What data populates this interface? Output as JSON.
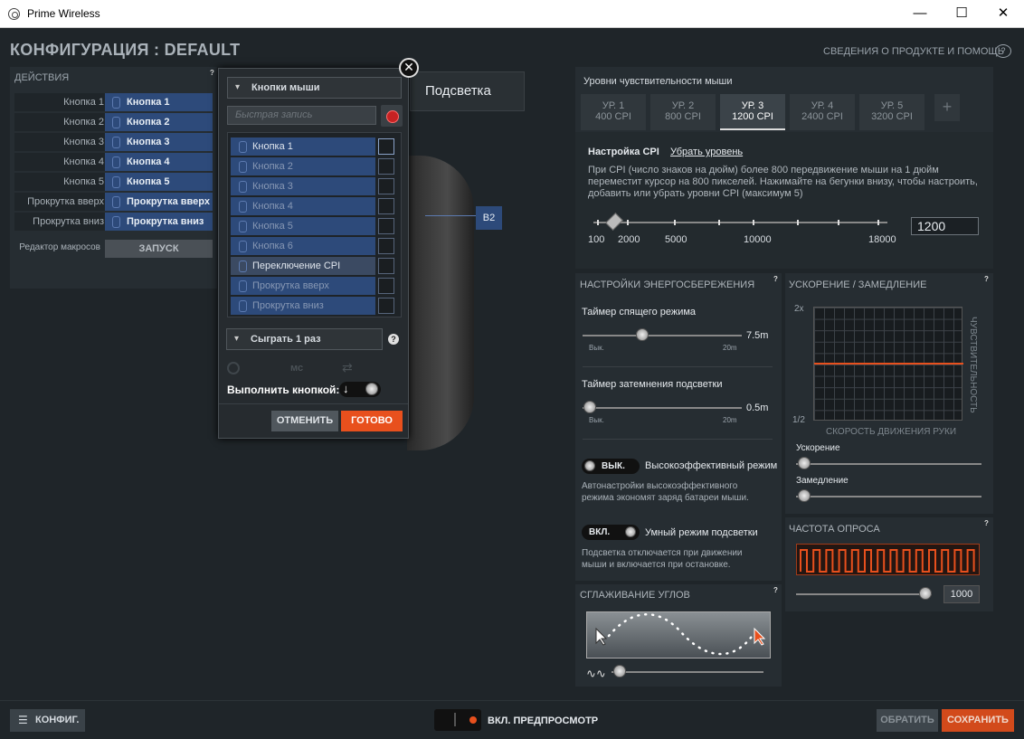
{
  "window": {
    "title": "Prime Wireless",
    "min": "—",
    "max": "☐",
    "close": "✕"
  },
  "header": {
    "title": "КОНФИГУРАЦИЯ : DEFAULT",
    "help": "СВЕДЕНИЯ О ПРОДУКТЕ И ПОМОЩЬ",
    "q": "?"
  },
  "actions": {
    "title": "ДЕЙСТВИЯ",
    "rows": [
      {
        "label": "Кнопка 1",
        "value": "Кнопка 1"
      },
      {
        "label": "Кнопка 2",
        "value": "Кнопка 2"
      },
      {
        "label": "Кнопка 3",
        "value": "Кнопка 3"
      },
      {
        "label": "Кнопка 4",
        "value": "Кнопка 4"
      },
      {
        "label": "Кнопка 5",
        "value": "Кнопка 5"
      },
      {
        "label": "Прокрутка вверх",
        "value": "Прокрутка вверх"
      },
      {
        "label": "Прокрутка вниз",
        "value": "Прокрутка вниз"
      }
    ],
    "macro_label": "Редактор макросов",
    "launch": "ЗАПУСК"
  },
  "popup": {
    "category": "Кнопки мыши",
    "quick_placeholder": "Быстрая запись",
    "buttons": [
      "Кнопка 1",
      "Кнопка 2",
      "Кнопка 3",
      "Кнопка 4",
      "Кнопка 5",
      "Кнопка 6",
      "Переключение CPI",
      "Прокрутка вверх",
      "Прокрутка вниз"
    ],
    "play": "Сыграть 1 раз",
    "ms": "мс",
    "execute": "Выполнить кнопкой:",
    "cancel": "ОТМЕНИТЬ",
    "done": "ГОТОВО",
    "close": "✕",
    "q": "?"
  },
  "backlight_tab": "Подсветка",
  "mouse": {
    "b2": "B2"
  },
  "sensitivity": {
    "title": "Уровни чувствительности мыши",
    "levels": [
      {
        "name": "УР. 1",
        "cpi": "400 CPI"
      },
      {
        "name": "УР. 2",
        "cpi": "800 CPI"
      },
      {
        "name": "УР. 3",
        "cpi": "1200 CPI"
      },
      {
        "name": "УР. 4",
        "cpi": "2400 CPI"
      },
      {
        "name": "УР. 5",
        "cpi": "3200 CPI"
      }
    ],
    "active_level": 3,
    "add": "+",
    "cpi_settings": "Настройка CPI",
    "remove_level": "Убрать уровень",
    "desc": "При CPI (число знаков на дюйм) более 800 передвижение мыши на 1 дюйм переместит курсор на 800 пикселей. Нажимайте на бегунки внизу, чтобы настроить, добавить или убрать уровни CPI (максимум 5)",
    "scale": [
      "100",
      "2000",
      "5000",
      "10000",
      "18000"
    ],
    "value": "1200"
  },
  "power": {
    "title": "НАСТРОЙКИ ЭНЕРГОСБЕРЕЖЕНИЯ",
    "q": "?",
    "sleep": {
      "label": "Таймер спящего режима",
      "min": "Вык.",
      "max": "20m",
      "value": "7.5m",
      "fraction": 0.375
    },
    "dim": {
      "label": "Таймер затемнения подсветки",
      "min": "Вык.",
      "max": "20m",
      "value": "0.5m",
      "fraction": 0.025
    },
    "hi_eff": {
      "state": "ВЫК.",
      "label": "Высокоэффективный режим",
      "desc": "Автонастройки высокоэффективного режима экономят заряд батареи мыши."
    },
    "smart": {
      "state": "ВКЛ.",
      "label": "Умный режим подсветки",
      "desc": "Подсветка отключается при движении мыши и включается при остановке."
    }
  },
  "accel": {
    "title": "УСКОРЕНИЕ / ЗАМЕДЛЕНИЕ",
    "q": "?",
    "y_top": "2x",
    "y_bot": "1/2",
    "y_axis": "ЧУВСТВИТЕЛЬНОСТЬ",
    "x_axis": "СКОРОСТЬ ДВИЖЕНИЯ РУКИ",
    "accel": "Ускорение",
    "decel": "Замедление"
  },
  "polling": {
    "title": "ЧАСТОТА ОПРОСА",
    "q": "?",
    "value": "1000"
  },
  "smoothing": {
    "title": "СГЛАЖИВАНИЕ УГЛОВ",
    "q": "?"
  },
  "footer": {
    "config": "КОНФИГ.",
    "preview": "ВКЛ. ПРЕДПРОСМОТР",
    "revert": "ОБРАТИТЬ",
    "save": "СОХРАНИТЬ"
  },
  "colors": {
    "accent": "#e8501d",
    "blue": "#2d4a7a"
  }
}
